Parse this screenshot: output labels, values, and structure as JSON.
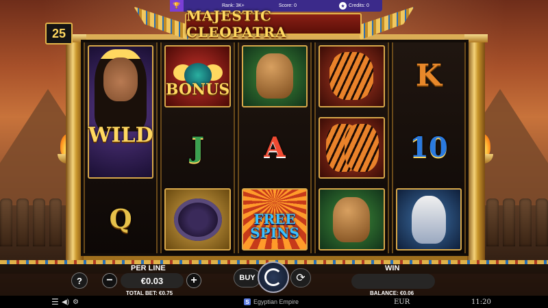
{
  "topbar": {
    "trophy_icon": "trophy-icon",
    "rank": "Rank: 3K+",
    "score": "Score: 0",
    "credits_icon": "star-icon",
    "credits": "Credits: 0"
  },
  "game": {
    "title": "MAJESTIC CLEOPATRA",
    "lines": "25"
  },
  "reels": [
    [
      {
        "symbol": "cleopatra-wild",
        "label": "WILD"
      },
      {
        "symbol": "card-q",
        "label": "Q"
      }
    ],
    [
      {
        "symbol": "scarab-bonus",
        "label": "BONUS"
      },
      {
        "symbol": "card-j",
        "label": "J"
      },
      {
        "symbol": "cobra",
        "label": ""
      }
    ],
    [
      {
        "symbol": "camel",
        "label": ""
      },
      {
        "symbol": "card-a",
        "label": "A"
      },
      {
        "symbol": "free-spins",
        "label": "FREE SPINS"
      }
    ],
    [
      {
        "symbol": "tiger",
        "label": ""
      },
      {
        "symbol": "tigers",
        "label": ""
      },
      {
        "symbol": "camel",
        "label": ""
      }
    ],
    [
      {
        "symbol": "card-k",
        "label": "K"
      },
      {
        "symbol": "card-10",
        "label": "10"
      },
      {
        "symbol": "ibis",
        "label": ""
      }
    ]
  ],
  "controls": {
    "per_line_label": "PER LINE",
    "per_line_value": "€0.03",
    "minus": "−",
    "plus": "+",
    "total_bet": "TOTAL BET: €0.75",
    "buy_label": "BUY",
    "autoplay_icon": "autoplay-icon",
    "autoplay_glyph": "⟳",
    "spin_icon": "spin-icon",
    "win_label": "WIN",
    "win_value": "",
    "balance": "BALANCE: €0.06",
    "help": "?"
  },
  "footer": {
    "menu_glyph": "☰",
    "sound_glyph": "🔊",
    "turbo_glyph": "⚡",
    "brand_logo": "S",
    "brand": "Egyptian Empire",
    "currency": "EUR",
    "clock": "11:20"
  },
  "colors": {
    "gold": "#ffd860",
    "topbar": "#3b2a8a",
    "banner": "#8a1f14"
  }
}
